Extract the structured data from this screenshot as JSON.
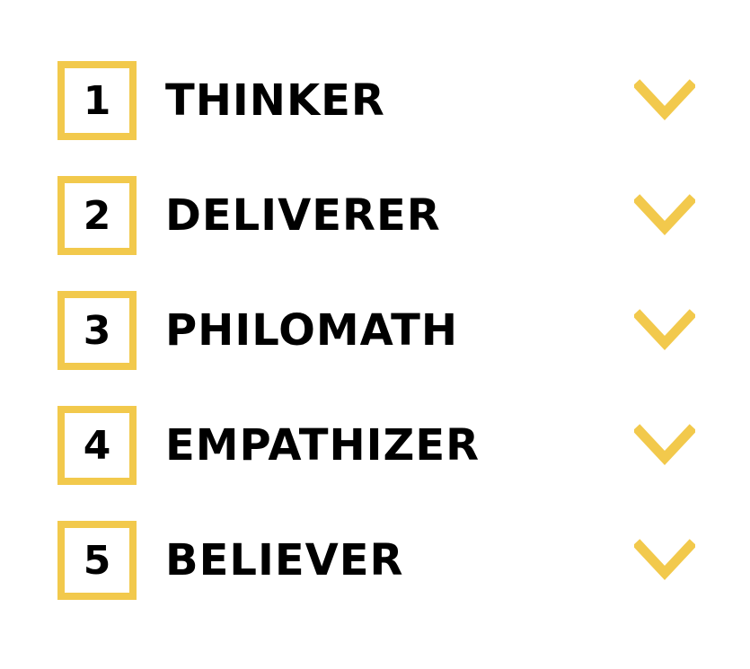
{
  "colors": {
    "accent": "#f2c94c",
    "text": "#000000",
    "background": "#ffffff"
  },
  "items": [
    {
      "number": "1",
      "label": "THINKER",
      "icon": "chevron-down-icon"
    },
    {
      "number": "2",
      "label": "DELIVERER",
      "icon": "chevron-down-icon"
    },
    {
      "number": "3",
      "label": "PHILOMATH",
      "icon": "chevron-down-icon"
    },
    {
      "number": "4",
      "label": "EMPATHIZER",
      "icon": "chevron-down-icon"
    },
    {
      "number": "5",
      "label": "BELIEVER",
      "icon": "chevron-down-icon"
    }
  ]
}
